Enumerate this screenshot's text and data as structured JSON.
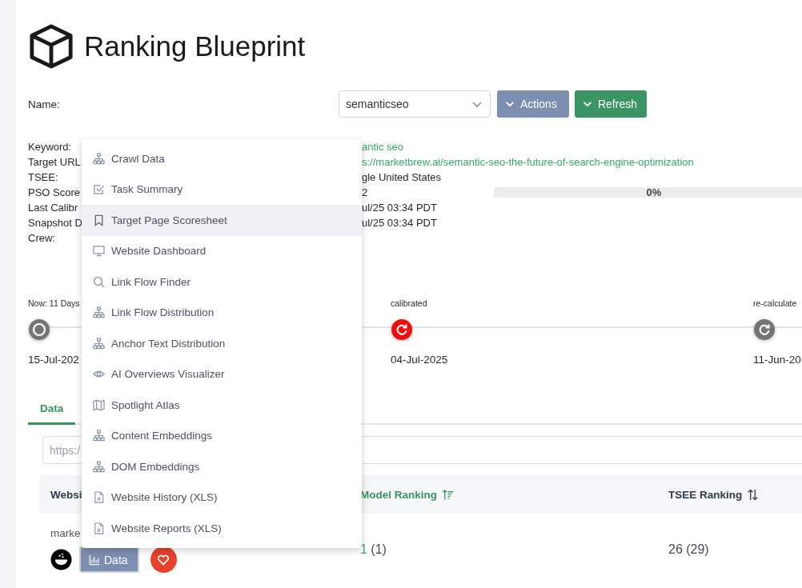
{
  "title": "Ranking Blueprint",
  "name_row": {
    "label": "Name:",
    "select_value": "semanticseo",
    "buttons": [
      {
        "label": "Actions",
        "kind": "secondary"
      },
      {
        "label": "Refresh",
        "kind": "success"
      }
    ]
  },
  "info": [
    {
      "label": "Keyword:",
      "value": "antic seo",
      "kind": "link"
    },
    {
      "label": "Target URL",
      "value": "s://marketbrew.ai/semantic-seo-the-future-of-search-engine-optimization",
      "kind": "link"
    },
    {
      "label": "TSEE:",
      "value": "gle United States",
      "kind": "text"
    },
    {
      "label": "PSO Score",
      "value": "2",
      "kind": "progress",
      "level": 0,
      "reading": "0%"
    },
    {
      "label": "Last Calibr",
      "value": "ul/25 03:34 PDT",
      "kind": "text"
    },
    {
      "label": "Snapshot D",
      "value": "ul/25 03:34 PDT",
      "kind": "text"
    },
    {
      "label": "Crew:",
      "kind": "text"
    }
  ],
  "timeline": [
    {
      "label": "Now: 11 Days",
      "date": "15-Jul-202",
      "kind": "now",
      "color": "#757575"
    },
    {
      "label": "calibrated",
      "date": "04-Jul-2025",
      "kind": "refresh",
      "color": "#f20d0d"
    },
    {
      "label": "re-calculate",
      "date": "11-Jun-20",
      "kind": "refresh",
      "color": "#757575"
    }
  ],
  "tabs": [
    {
      "label": "Data",
      "selected": true
    }
  ],
  "filter": {
    "placeholder": "https:/"
  },
  "table": {
    "columns": [
      {
        "label": "Websi"
      },
      {
        "label": "Model Ranking",
        "sorted": true,
        "sortable": true
      },
      {
        "label": "TSEE Ranking",
        "sorted": false,
        "sortable": true
      }
    ],
    "rows": [
      {
        "website": "marke",
        "data_button": "Data",
        "favorite": true,
        "model_rank": "1",
        "model_rank_prev": "(1)",
        "tsee_rank": "26 (29)"
      }
    ]
  },
  "menu": {
    "items": [
      {
        "label": "Crawl Data",
        "selected": false
      },
      {
        "label": "Task Summary",
        "selected": false
      },
      {
        "label": "Target Page Scoresheet",
        "selected": true
      },
      {
        "label": "Website Dashboard",
        "selected": false
      },
      {
        "label": "Link Flow Finder",
        "selected": false
      },
      {
        "label": "Link Flow Distribution",
        "selected": false
      },
      {
        "label": "Anchor Text Distribution",
        "selected": false
      },
      {
        "label": "AI Overviews Visualizer",
        "selected": false
      },
      {
        "label": "Spotlight Atlas",
        "selected": false
      },
      {
        "label": "Content Embeddings",
        "selected": false
      },
      {
        "label": "DOM Embeddings",
        "selected": false
      },
      {
        "label": "Website History (XLS)",
        "selected": false
      },
      {
        "label": "Website Reports (XLS)",
        "selected": false
      }
    ]
  }
}
